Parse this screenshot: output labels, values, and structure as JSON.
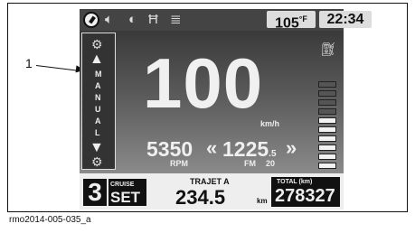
{
  "callout": {
    "label": "1"
  },
  "caption": "rmo2014-005-035_a",
  "topbar": {
    "icons": [
      "speedometer-icon",
      "speaker-icon",
      "headlight-icon",
      "road-icon",
      "menu-icon"
    ],
    "temperature": "105",
    "temperature_unit": "°F",
    "clock": "22:34"
  },
  "gear_strip": {
    "icon_top": "gear-shift-icon",
    "up_arrow": "▲",
    "letters": [
      "M",
      "A",
      "N",
      "U",
      "A",
      "L"
    ],
    "down_arrow": "▼",
    "icon_bottom": "gear-shift-icon"
  },
  "speed": {
    "value": "100",
    "unit": "km/h"
  },
  "rpm": {
    "value": "5350",
    "label": "RPM"
  },
  "radio": {
    "arrows_left": "«",
    "value_main": "1225",
    "value_dec": ".5",
    "arrows_right": "»",
    "band": "FM",
    "preset": "20"
  },
  "fuel": {
    "icon": "fuel-pump-icon",
    "level_fraction": 0.6
  },
  "bottom": {
    "gear": "3",
    "cruise_label": "CRUISE",
    "cruise_state": "SET",
    "trip_label": "TRAJET A",
    "trip_value": "234.5",
    "trip_unit": "km",
    "total_label": "TOTAL (km)",
    "total_value": "278327"
  }
}
